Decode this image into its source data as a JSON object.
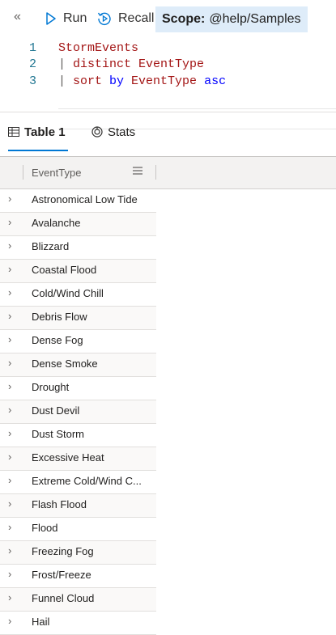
{
  "toolbar": {
    "run_label": "Run",
    "recall_label": "Recall",
    "scope_label": "Scope:",
    "scope_value": "@help/Samples"
  },
  "editor": {
    "lines": [
      {
        "number": "1",
        "tokens": [
          {
            "text": "StormEvents",
            "kind": "table"
          }
        ]
      },
      {
        "number": "2",
        "tokens": [
          {
            "text": "| ",
            "kind": "bar"
          },
          {
            "text": "distinct ",
            "kind": "op"
          },
          {
            "text": "EventType",
            "kind": "col"
          }
        ]
      },
      {
        "number": "3",
        "tokens": [
          {
            "text": "| ",
            "kind": "bar"
          },
          {
            "text": "sort ",
            "kind": "op"
          },
          {
            "text": "by ",
            "kind": "kw"
          },
          {
            "text": "EventType ",
            "kind": "col"
          },
          {
            "text": "asc",
            "kind": "kw"
          }
        ]
      }
    ]
  },
  "tabs": [
    {
      "label": "Table 1",
      "active": true
    },
    {
      "label": "Stats",
      "active": false
    }
  ],
  "grid": {
    "column_header": "EventType",
    "rows": [
      "Astronomical Low Tide",
      "Avalanche",
      "Blizzard",
      "Coastal Flood",
      "Cold/Wind Chill",
      "Debris Flow",
      "Dense Fog",
      "Dense Smoke",
      "Drought",
      "Dust Devil",
      "Dust Storm",
      "Excessive Heat",
      "Extreme Cold/Wind C...",
      "Flash Flood",
      "Flood",
      "Freezing Fog",
      "Frost/Freeze",
      "Funnel Cloud",
      "Hail"
    ]
  }
}
